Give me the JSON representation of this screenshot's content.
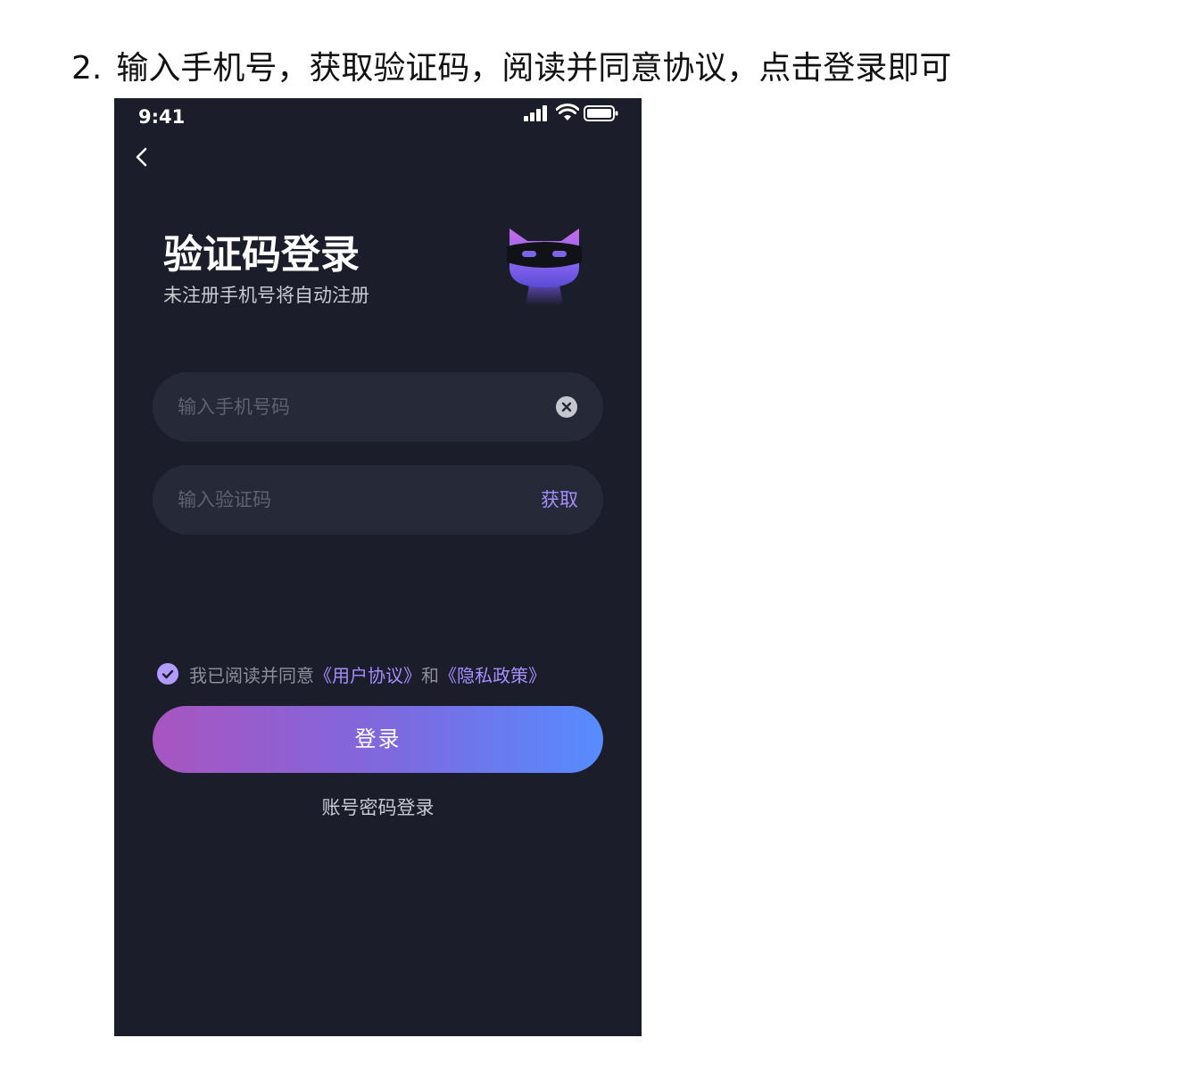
{
  "instruction": {
    "number": "2.",
    "text": "输入手机号，获取验证码，阅读并同意协议，点击登录即可"
  },
  "status_bar": {
    "time": "9:41",
    "icons": [
      "signal-icon",
      "wifi-icon",
      "battery-icon"
    ]
  },
  "header": {
    "title": "验证码登录",
    "subtitle": "未注册手机号将自动注册"
  },
  "form": {
    "phone_placeholder": "输入手机号码",
    "code_placeholder": "输入验证码",
    "get_code_label": "获取"
  },
  "agreement": {
    "checked": true,
    "prefix": "我已阅读并同意",
    "user_agreement": "《用户协议》",
    "connector": "和",
    "privacy_policy": "《隐私政策》"
  },
  "buttons": {
    "login_label": "登录",
    "password_login_label": "账号密码登录"
  },
  "colors": {
    "phone_bg": "#1b1d2a",
    "field_bg": "#262937",
    "accent": "#a68dff",
    "gradient_start": "#a855c0",
    "gradient_end": "#568cff"
  }
}
